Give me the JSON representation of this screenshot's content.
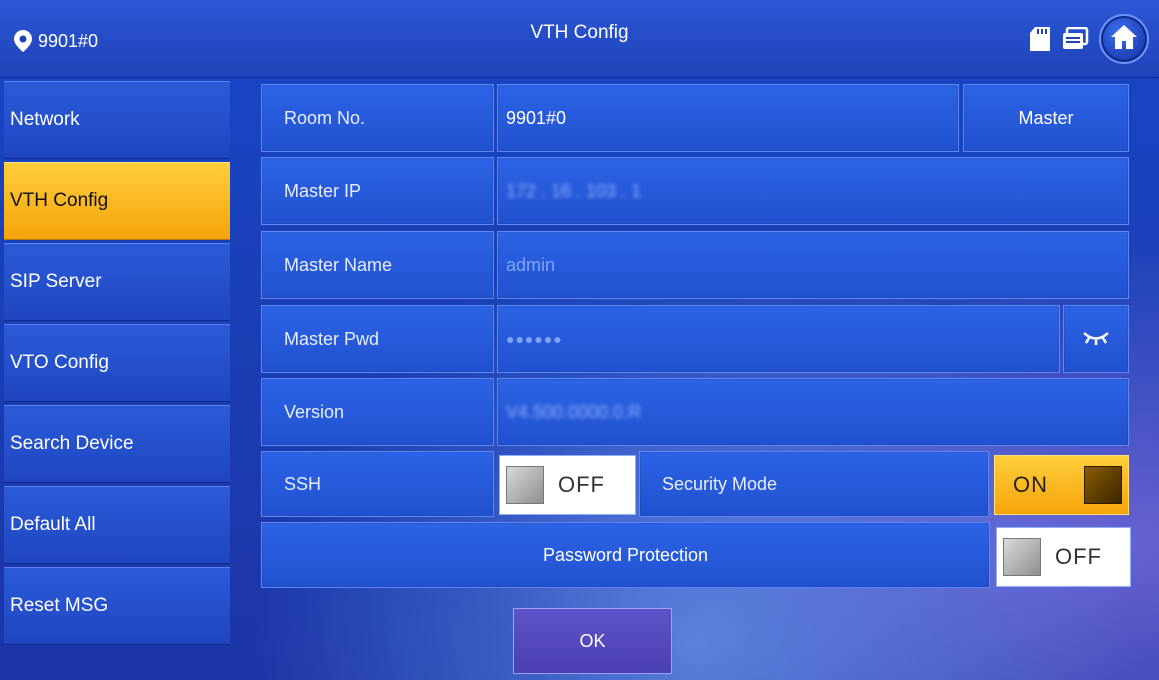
{
  "header": {
    "location": "9901#0",
    "title": "VTH Config"
  },
  "sidebar": {
    "items": [
      {
        "label": "Network"
      },
      {
        "label": "VTH Config"
      },
      {
        "label": "SIP Server"
      },
      {
        "label": "VTO Config"
      },
      {
        "label": "Search Device"
      },
      {
        "label": "Default All"
      },
      {
        "label": "Reset MSG"
      }
    ],
    "active": "VTH Config"
  },
  "form": {
    "room_no": {
      "label": "Room No.",
      "value": "9901#0",
      "role_button": "Master"
    },
    "master_ip": {
      "label": "Master IP",
      "value": "172 . 16 . 103 . 1"
    },
    "master_name": {
      "label": "Master Name",
      "value": "admin"
    },
    "master_pwd": {
      "label": "Master Pwd",
      "value": "●●●●●●"
    },
    "version": {
      "label": "Version",
      "value": "V4.500.0000.0.R"
    },
    "ssh": {
      "label": "SSH",
      "state": "OFF"
    },
    "security_mode": {
      "label": "Security Mode",
      "state": "ON"
    },
    "password_protection": {
      "label": "Password Protection",
      "state": "OFF"
    }
  },
  "ok_label": "OK",
  "colors": {
    "accent_active": "#f5a40c",
    "panel_blue": "#2151cf",
    "background_blue": "#1a3fb6"
  }
}
